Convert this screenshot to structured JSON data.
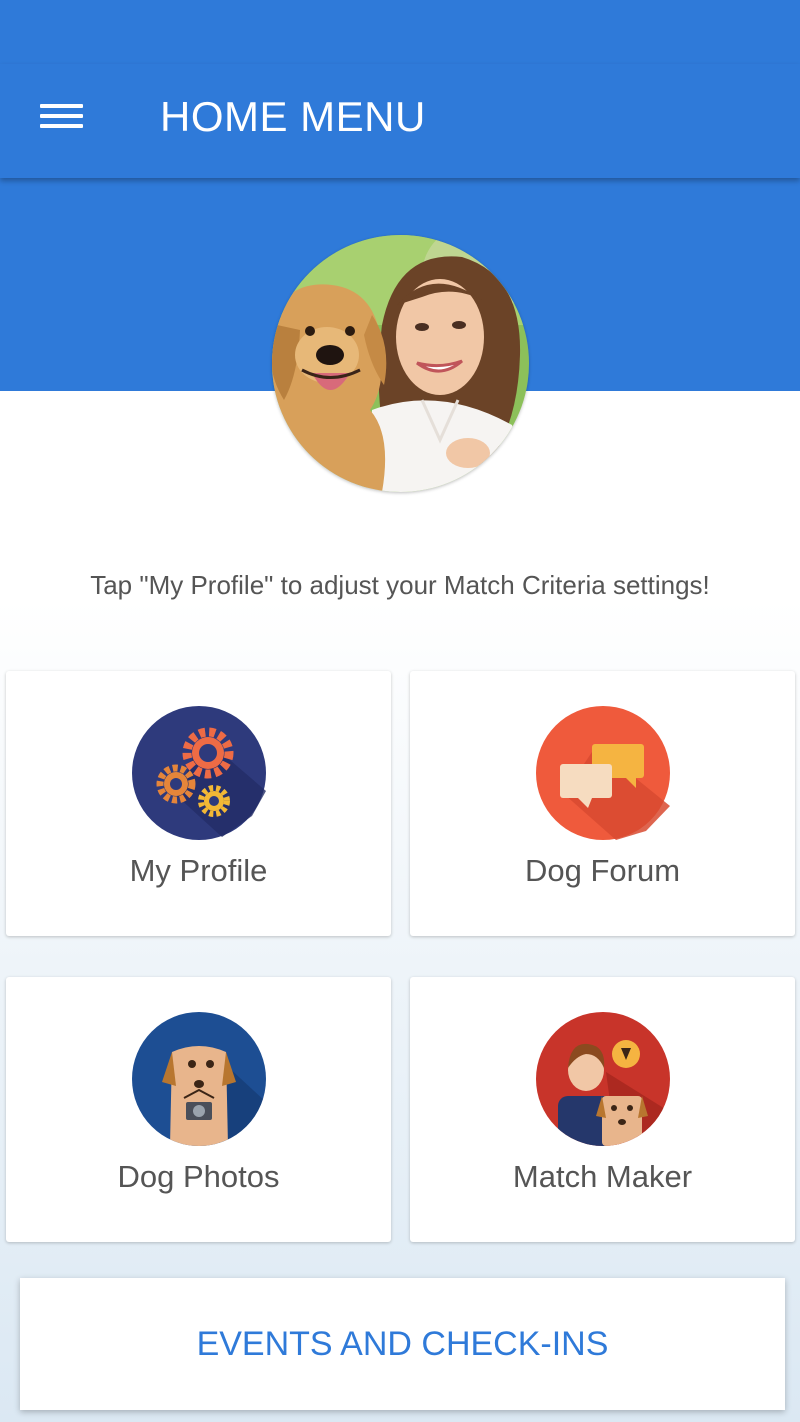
{
  "app_bar": {
    "title": "HOME MENU",
    "menu_icon": "hamburger-menu-icon"
  },
  "profile": {
    "avatar_alt": "Profile photo"
  },
  "hint": "Tap \"My Profile\" to adjust your Match Criteria settings!",
  "menu_tiles": [
    {
      "label": "My Profile",
      "icon": "gears-icon",
      "icon_bg": "#2e3a7c"
    },
    {
      "label": "Dog Forum",
      "icon": "chat-bubbles-icon",
      "icon_bg": "#ef5a3c"
    },
    {
      "label": "Dog Photos",
      "icon": "dog-camera-icon",
      "icon_bg": "#1d4e93"
    },
    {
      "label": "Match Maker",
      "icon": "person-with-dog-icon",
      "icon_bg": "#c8342a"
    }
  ],
  "events_button": {
    "label": "EVENTS AND CHECK-INS"
  },
  "colors": {
    "primary": "#2f7ad9",
    "text": "#555555",
    "card": "#ffffff"
  }
}
